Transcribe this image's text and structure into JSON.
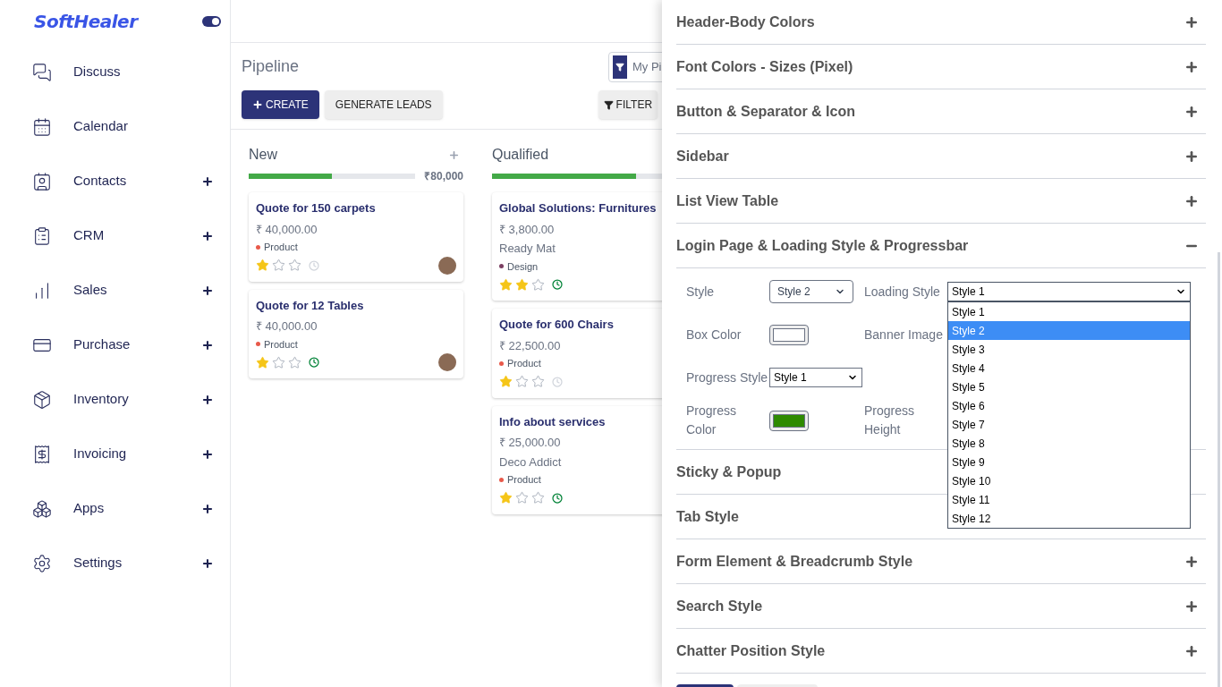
{
  "brand": {
    "name": "SoftHealer",
    "toggle_on": true
  },
  "sidebar": {
    "items": [
      {
        "label": "Discuss",
        "expandable": false
      },
      {
        "label": "Calendar",
        "expandable": false
      },
      {
        "label": "Contacts",
        "expandable": true
      },
      {
        "label": "CRM",
        "expandable": true
      },
      {
        "label": "Sales",
        "expandable": true
      },
      {
        "label": "Purchase",
        "expandable": true
      },
      {
        "label": "Inventory",
        "expandable": true
      },
      {
        "label": "Invoicing",
        "expandable": true
      },
      {
        "label": "Apps",
        "expandable": true
      },
      {
        "label": "Settings",
        "expandable": true
      }
    ]
  },
  "control_panel": {
    "title": "Pipeline",
    "search_facet": "My Pi",
    "create_button": "CREATE",
    "generate_button": "GENERATE LEADS",
    "filters_button": "FILTER"
  },
  "kanban": {
    "columns": [
      {
        "name": "New",
        "addable": true,
        "total": "₹80,000",
        "level": 0.5,
        "cards": [
          {
            "title": "Quote for 150 carpets",
            "amount": "₹ 40,000.00",
            "tag": {
              "label": "Product",
              "color": "#e8594a"
            },
            "stars": 1,
            "activity_scheduled": false,
            "avatar": true
          },
          {
            "title": "Quote for 12 Tables",
            "amount": "₹ 40,000.00",
            "tag": {
              "label": "Product",
              "color": "#e8594a"
            },
            "stars": 1,
            "activity_scheduled": true,
            "avatar": true
          }
        ]
      },
      {
        "name": "Qualified",
        "addable": false,
        "level": 0.67,
        "cards": [
          {
            "title": "Global Solutions: Furnitures",
            "amount": "₹ 3,800.00",
            "partner": "Ready Mat",
            "tag": {
              "label": "Design",
              "color": "#7b3f62"
            },
            "stars": 2,
            "activity_scheduled": true,
            "avatar": false
          },
          {
            "title": "Quote for 600 Chairs",
            "amount": "₹ 22,500.00",
            "tag": {
              "label": "Product",
              "color": "#e8594a"
            },
            "stars": 1,
            "activity_scheduled": false,
            "avatar": false
          },
          {
            "title": "Info about services",
            "amount": "₹ 25,000.00",
            "partner": "Deco Addict",
            "tag": {
              "label": "Product",
              "color": "#e8594a"
            },
            "stars": 1,
            "activity_scheduled": true,
            "avatar": false
          }
        ]
      }
    ]
  },
  "settings_panel": {
    "sections": [
      {
        "title": "Header-Body Colors",
        "expanded": false
      },
      {
        "title": "Font Colors - Sizes (Pixel)",
        "expanded": false
      },
      {
        "title": "Button & Separator & Icon",
        "expanded": false
      },
      {
        "title": "Sidebar",
        "expanded": false
      },
      {
        "title": "List View Table",
        "expanded": false
      },
      {
        "title": "Login Page & Loading Style & Progressbar",
        "expanded": true,
        "fields": [
          {
            "label": "Style",
            "kind": "select",
            "value": "Style 2"
          },
          {
            "label": "Loading Style",
            "kind": "dropdown",
            "value": "Style 1",
            "open": true,
            "options": [
              {
                "label": "Style 1",
                "highlighted": false
              },
              {
                "label": "Style 2",
                "highlighted": true
              },
              {
                "label": "Style 3",
                "highlighted": false
              },
              {
                "label": "Style 4",
                "highlighted": false
              },
              {
                "label": "Style 5",
                "highlighted": false
              },
              {
                "label": "Style 6",
                "highlighted": false
              },
              {
                "label": "Style 7",
                "highlighted": false
              },
              {
                "label": "Style 8",
                "highlighted": false
              },
              {
                "label": "Style 9",
                "highlighted": false
              },
              {
                "label": "Style 10",
                "highlighted": false
              },
              {
                "label": "Style 11",
                "highlighted": false
              },
              {
                "label": "Style 12",
                "highlighted": false
              }
            ]
          },
          {
            "label": "Box Color",
            "kind": "color",
            "color": "#ffffff"
          },
          {
            "label": "Banner Image",
            "kind": "label"
          },
          {
            "label": "Progress Style",
            "kind": "select_plain",
            "value": "Style 1"
          },
          {
            "kind": "empty"
          },
          {
            "label": "Progress Color",
            "kind": "color",
            "color": "#2e8a00"
          },
          {
            "label": "Progress Height",
            "kind": "label"
          }
        ]
      },
      {
        "title": "Sticky & Popup"
      },
      {
        "title": "Tab Style"
      },
      {
        "title": "Form Element & Breadcrumb Style",
        "expanded": false
      },
      {
        "title": "Search Style",
        "expanded": false
      },
      {
        "title": "Chatter Position Style",
        "expanded": false
      }
    ]
  }
}
